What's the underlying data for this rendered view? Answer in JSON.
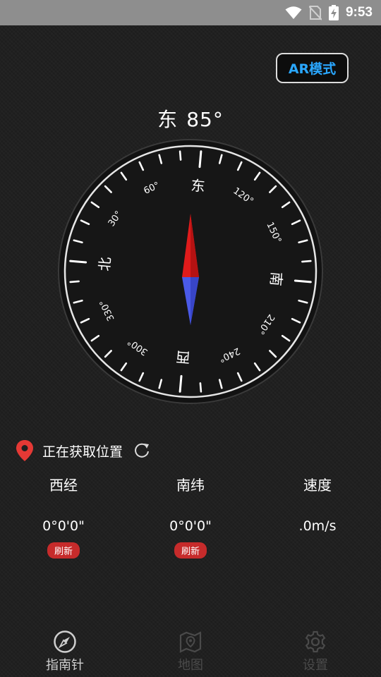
{
  "status_bar": {
    "time": "9:53"
  },
  "ar_button": {
    "label": "AR模式"
  },
  "heading": {
    "direction": "东",
    "degrees": "85°"
  },
  "compass": {
    "cardinals": {
      "north": "北",
      "east": "东",
      "south": "南",
      "west": "西"
    },
    "degree_labels": [
      "30°",
      "60°",
      "120°",
      "150°",
      "210°",
      "240°",
      "300°",
      "330°"
    ]
  },
  "location": {
    "status": "正在获取位置"
  },
  "info": {
    "longitude": {
      "label": "西经",
      "value": "0°0'0\"",
      "refresh": "刷新"
    },
    "latitude": {
      "label": "南纬",
      "value": "0°0'0\"",
      "refresh": "刷新"
    },
    "speed": {
      "label": "速度",
      "value": ".0m/s"
    }
  },
  "tabs": [
    {
      "label": "指南针",
      "icon": "compass-icon",
      "active": true
    },
    {
      "label": "地图",
      "icon": "map-icon",
      "active": false
    },
    {
      "label": "设置",
      "icon": "gear-icon",
      "active": false
    }
  ],
  "colors": {
    "accent": "#2aa7ff",
    "needle_north": "#e01b1b",
    "needle_south": "#4a5ae8",
    "badge": "#c62b2b",
    "location_pin": "#e53935"
  }
}
